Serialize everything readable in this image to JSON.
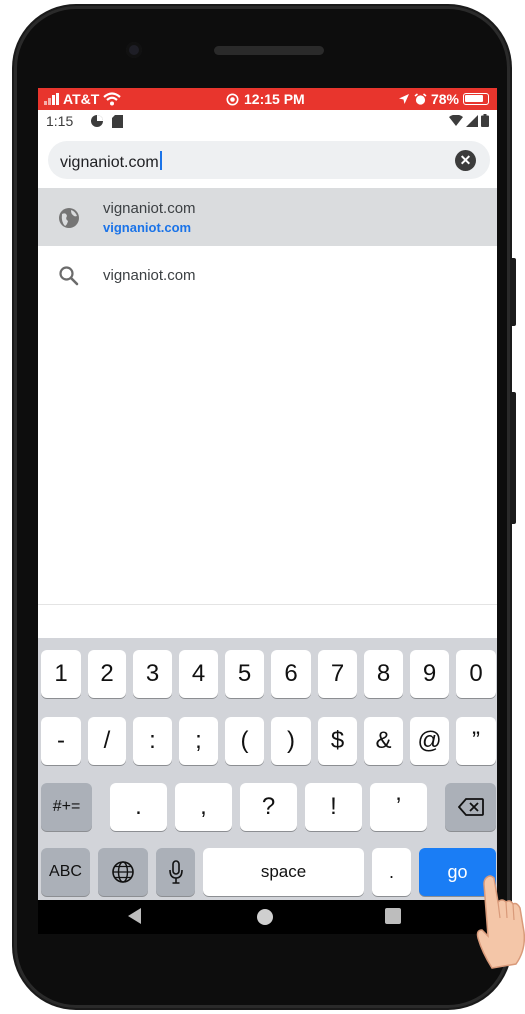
{
  "ios_status": {
    "carrier": "AT&T",
    "time": "12:15 PM",
    "battery": "78%",
    "bar_color": "#e8352d"
  },
  "android_status": {
    "time": "1:15"
  },
  "address_bar": {
    "value": "vignaniot.com",
    "clear_icon": "close-circle-icon"
  },
  "suggestions": [
    {
      "icon": "globe-icon",
      "title": "vignaniot.com",
      "url": "vignaniot.com"
    },
    {
      "icon": "search-icon",
      "title": "vignaniot.com"
    }
  ],
  "keyboard": {
    "row1": [
      "1",
      "2",
      "3",
      "4",
      "5",
      "6",
      "7",
      "8",
      "9",
      "0"
    ],
    "row2": [
      "-",
      "/",
      ":",
      ";",
      "(",
      ")",
      "$",
      "&",
      "@",
      "”"
    ],
    "row3": {
      "mode": "#+=",
      "keys": [
        ".",
        ",",
        "?",
        "!",
        "’"
      ],
      "delete_icon": "backspace-icon"
    },
    "row4": {
      "abc": "ABC",
      "globe_icon": "globe-icon",
      "mic_icon": "microphone-icon",
      "space": "space",
      "dot": ".",
      "go": "go"
    },
    "accent_color": "#1a7df5"
  },
  "navigation": {
    "back_icon": "back-triangle-icon",
    "home_icon": "home-circle-icon",
    "recents_icon": "recents-square-icon"
  }
}
